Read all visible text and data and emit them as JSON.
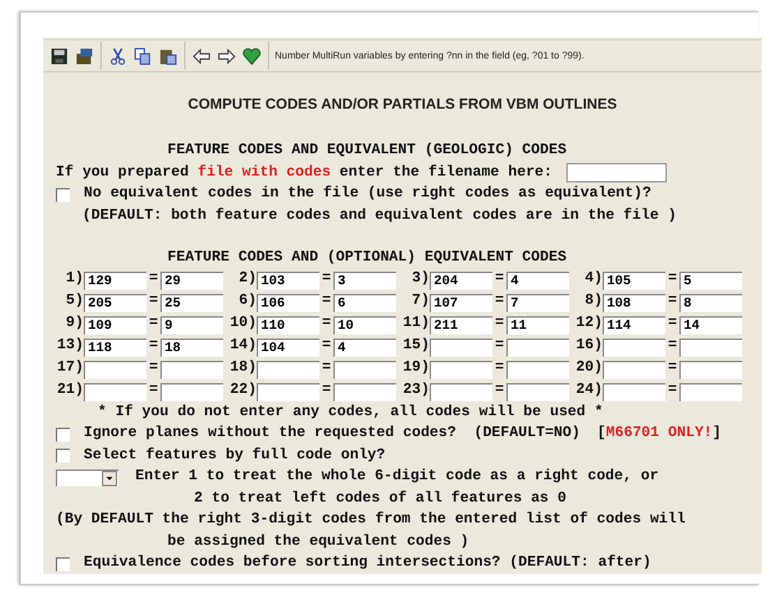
{
  "toolbar": {
    "hint": "Number MultiRun variables by entering ?nn in the field (eg, ?01 to ?99)."
  },
  "title": "COMPUTE CODES AND/OR PARTIALS FROM VBM OUTLINES",
  "file_section": {
    "heading": "FEATURE CODES AND EQUIVALENT (GEOLOGIC) CODES",
    "prompt": [
      {
        "text": "If you prepared ",
        "highlighted": false
      },
      {
        "text": "file with codes",
        "highlighted": true
      },
      {
        "text": " enter the filename here:",
        "highlighted": false
      }
    ],
    "no_equivalent": {
      "label": "No equivalent codes in the file (use right codes as equivalent)?",
      "checked": false
    },
    "default_note": "(DEFAULT: both feature codes and equivalent codes are in the file )"
  },
  "codes_section": {
    "heading": "FEATURE CODES AND (OPTIONAL) EQUIVALENT CODES",
    "entries": [
      {
        "label": "1)",
        "code": "129",
        "equivalent": "29"
      },
      {
        "label": "2)",
        "code": "103",
        "equivalent": "3"
      },
      {
        "label": "3)",
        "code": "204",
        "equivalent": "4"
      },
      {
        "label": "4)",
        "code": "105",
        "equivalent": "5"
      },
      {
        "label": "5)",
        "code": "205",
        "equivalent": "25"
      },
      {
        "label": "6)",
        "code": "106",
        "equivalent": "6"
      },
      {
        "label": "7)",
        "code": "107",
        "equivalent": "7"
      },
      {
        "label": "8)",
        "code": "108",
        "equivalent": "8"
      },
      {
        "label": "9)",
        "code": "109",
        "equivalent": "9"
      },
      {
        "label": "10)",
        "code": "110",
        "equivalent": "10"
      },
      {
        "label": "11)",
        "code": "211",
        "equivalent": "11"
      },
      {
        "label": "12)",
        "code": "114",
        "equivalent": "14"
      },
      {
        "label": "13)",
        "code": "118",
        "equivalent": "18"
      },
      {
        "label": "14)",
        "code": "104",
        "equivalent": "4"
      },
      {
        "label": "15)"
      },
      {
        "label": "16)"
      },
      {
        "label": "17)"
      },
      {
        "label": "18)"
      },
      {
        "label": "19)"
      },
      {
        "label": "20)"
      },
      {
        "label": "21)"
      },
      {
        "label": "22)"
      },
      {
        "label": "23)"
      },
      {
        "label": "24)"
      }
    ],
    "separator": "=",
    "note": "* If you do not enter any codes, all codes will be used *"
  },
  "ignore_planes": {
    "label": "Ignore planes without the requested codes?  (DEFAULT=NO)",
    "checked": false,
    "tag_open": "[",
    "tag": "M66701 ONLY!",
    "tag_close": "]"
  },
  "select_full_code": {
    "label": "Select features by full code only?",
    "checked": false
  },
  "treat_codes": {
    "lines": [
      "Enter 1 to treat the whole 6-digit code as a right code, or",
      "2 to treat left codes of all features as 0"
    ]
  },
  "default_assign": [
    "(By DEFAULT the right 3-digit codes from the entered list of codes will",
    "be assigned the equivalent codes )"
  ],
  "equivalence_before": {
    "label": "Equivalence codes before sorting intersections? (DEFAULT: after)",
    "checked": false
  }
}
